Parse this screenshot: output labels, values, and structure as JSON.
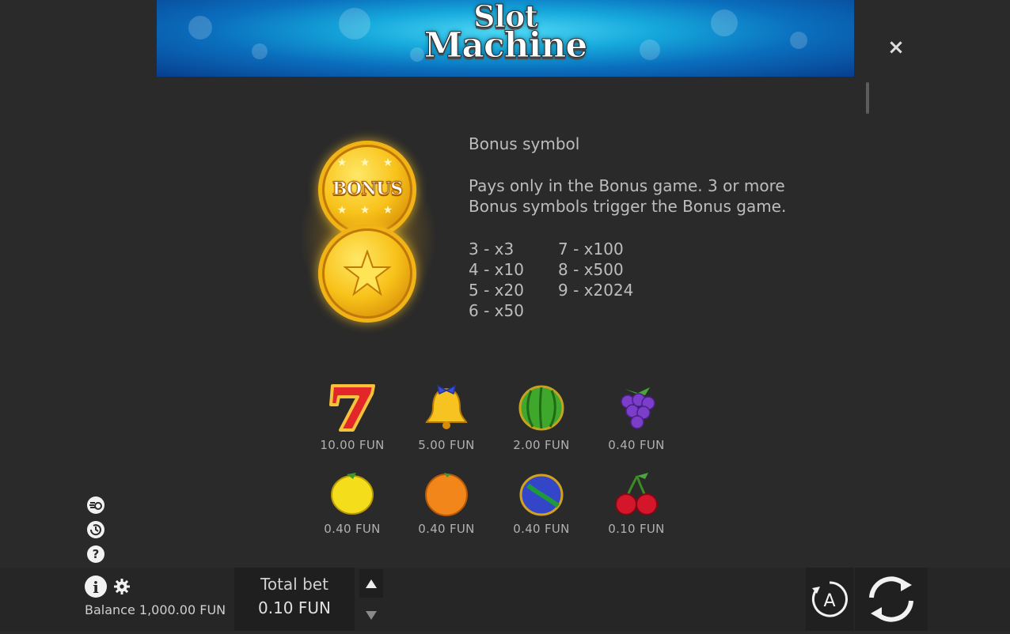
{
  "header": {
    "logo_line1": "Slot",
    "logo_line2": "Machine"
  },
  "controls": {
    "close_glyph": "×"
  },
  "bonus": {
    "coin_label": "BONUS",
    "title": "Bonus symbol",
    "description_line1": "Pays only in the Bonus game. 3 or more",
    "description_line2": "Bonus symbols trigger the Bonus game.",
    "pays_col1": [
      "3 - x3",
      "4 - x10",
      "5 - x20",
      "6 - x50"
    ],
    "pays_col2": [
      "7 - x100",
      "8 - x500",
      "9 - x2024"
    ]
  },
  "symbols": [
    {
      "icon": "seven-icon",
      "value": "10.00 FUN"
    },
    {
      "icon": "bell-icon",
      "value": "5.00 FUN"
    },
    {
      "icon": "watermelon-icon",
      "value": "2.00 FUN"
    },
    {
      "icon": "grapes-icon",
      "value": "0.40 FUN"
    },
    {
      "icon": "lemon-icon",
      "value": "0.40 FUN"
    },
    {
      "icon": "orange-icon",
      "value": "0.40 FUN"
    },
    {
      "icon": "plum-icon",
      "value": "0.40 FUN"
    },
    {
      "icon": "cherry-icon",
      "value": "0.10 FUN"
    }
  ],
  "side_icons": [
    "turbo-icon",
    "history-icon",
    "help-icon"
  ],
  "footer": {
    "balance": "Balance 1,000.00 FUN",
    "total_bet_label": "Total bet",
    "total_bet_value": "0.10 FUN",
    "autoplay_letter": "A"
  },
  "colors": {
    "background": "#2a2a2a",
    "gold": "#f8c21a",
    "banner": "#16a9dc"
  }
}
